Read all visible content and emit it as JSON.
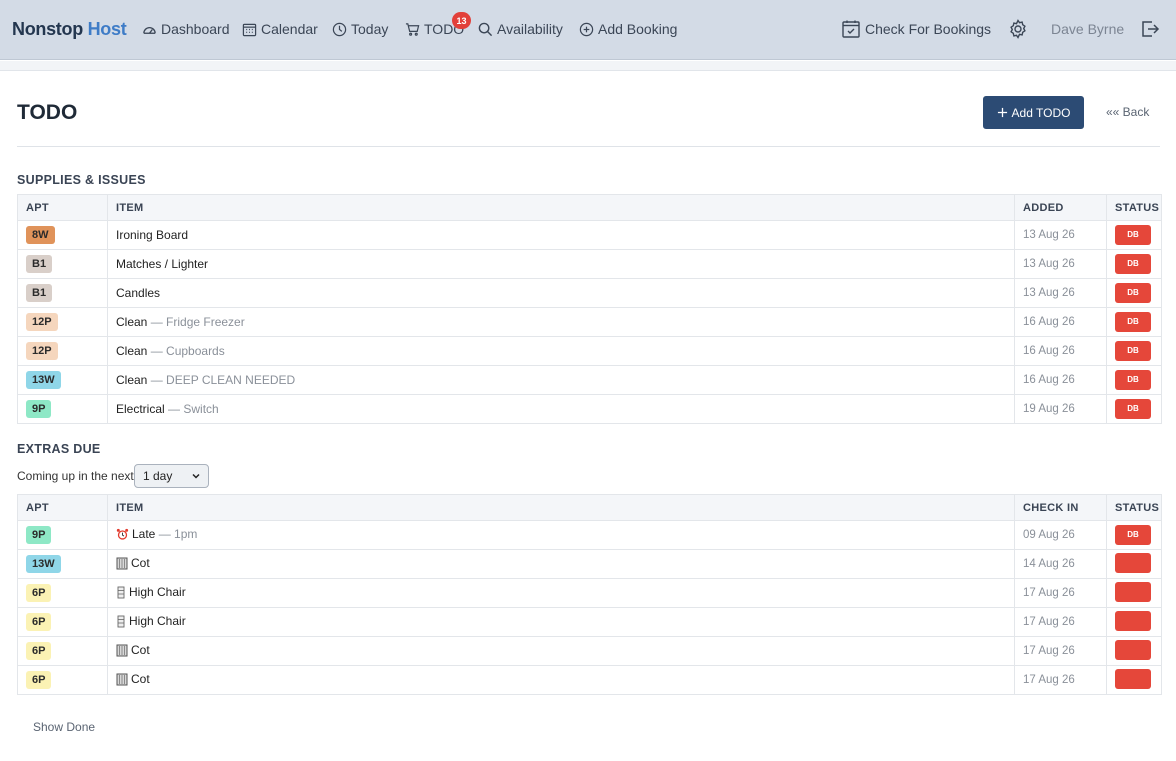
{
  "nav": {
    "brand_part1": "Nonstop",
    "brand_part2": "Host",
    "items": [
      {
        "label": "Dashboard",
        "icon": "gauge-icon"
      },
      {
        "label": "Calendar",
        "icon": "calendar-icon"
      },
      {
        "label": "Today",
        "icon": "clock-icon"
      },
      {
        "label": "TODO",
        "icon": "cart-icon",
        "badge": "13"
      },
      {
        "label": "Availability",
        "icon": "search-icon"
      },
      {
        "label": "Add Booking",
        "icon": "plus-circle-icon"
      }
    ],
    "check_label": "Check For Bookings",
    "user": "Dave Byrne"
  },
  "page": {
    "title": "TODO",
    "add_label": "Add TODO",
    "back_label": "«« Back"
  },
  "supplies": {
    "title": "SUPPLIES & ISSUES",
    "headers": [
      "APT",
      "ITEM",
      "ADDED",
      "STATUS"
    ],
    "rows": [
      {
        "apt": "8W",
        "apt_color": "#e0935a",
        "item": "Ironing Board",
        "sub": "",
        "date": "13 Aug 26",
        "status": "DB"
      },
      {
        "apt": "B1",
        "apt_color": "#d9cfc9",
        "item": "Matches / Lighter",
        "sub": "",
        "date": "13 Aug 26",
        "status": "DB"
      },
      {
        "apt": "B1",
        "apt_color": "#d9cfc9",
        "item": "Candles",
        "sub": "",
        "date": "13 Aug 26",
        "status": "DB"
      },
      {
        "apt": "12P",
        "apt_color": "#f5d6bd",
        "item": "Clean",
        "sub": " — Fridge Freezer",
        "date": "16 Aug 26",
        "status": "DB"
      },
      {
        "apt": "12P",
        "apt_color": "#f5d6bd",
        "item": "Clean",
        "sub": " — Cupboards",
        "date": "16 Aug 26",
        "status": "DB"
      },
      {
        "apt": "13W",
        "apt_color": "#8fd6e8",
        "item": "Clean",
        "sub": " — DEEP CLEAN NEEDED",
        "date": "16 Aug 26",
        "status": "DB"
      },
      {
        "apt": "9P",
        "apt_color": "#8ee8c6",
        "item": "Electrical",
        "sub": " — Switch",
        "date": "19 Aug 26",
        "status": "DB"
      }
    ]
  },
  "extras": {
    "title": "EXTRAS DUE",
    "filter_label": "Coming up in the next",
    "filter_value": "1 day",
    "headers": [
      "APT",
      "ITEM",
      "CHECK IN",
      "STATUS"
    ],
    "rows": [
      {
        "apt": "9P",
        "apt_color": "#8ee8c6",
        "icon": "alarm-clock-icon",
        "item": "Late",
        "sub": " — 1pm",
        "date": "09 Aug 26",
        "status": "DB"
      },
      {
        "apt": "13W",
        "apt_color": "#8fd6e8",
        "icon": "cot-icon",
        "item": "Cot",
        "sub": "",
        "date": "14 Aug 26",
        "status": ""
      },
      {
        "apt": "6P",
        "apt_color": "#fbf2b4",
        "icon": "high-chair-icon",
        "item": "High Chair",
        "sub": "",
        "date": "17 Aug 26",
        "status": ""
      },
      {
        "apt": "6P",
        "apt_color": "#fbf2b4",
        "icon": "high-chair-icon",
        "item": "High Chair",
        "sub": "",
        "date": "17 Aug 26",
        "status": ""
      },
      {
        "apt": "6P",
        "apt_color": "#fbf2b4",
        "icon": "cot-icon",
        "item": "Cot",
        "sub": "",
        "date": "17 Aug 26",
        "status": ""
      },
      {
        "apt": "6P",
        "apt_color": "#fbf2b4",
        "icon": "cot-icon",
        "item": "Cot",
        "sub": "",
        "date": "17 Aug 26",
        "status": ""
      }
    ]
  },
  "footer": {
    "show_done": "Show Done"
  },
  "colors": {
    "nav_bg": "#d3dbe6",
    "primary": "#2c4b74",
    "danger": "#e5473a"
  }
}
